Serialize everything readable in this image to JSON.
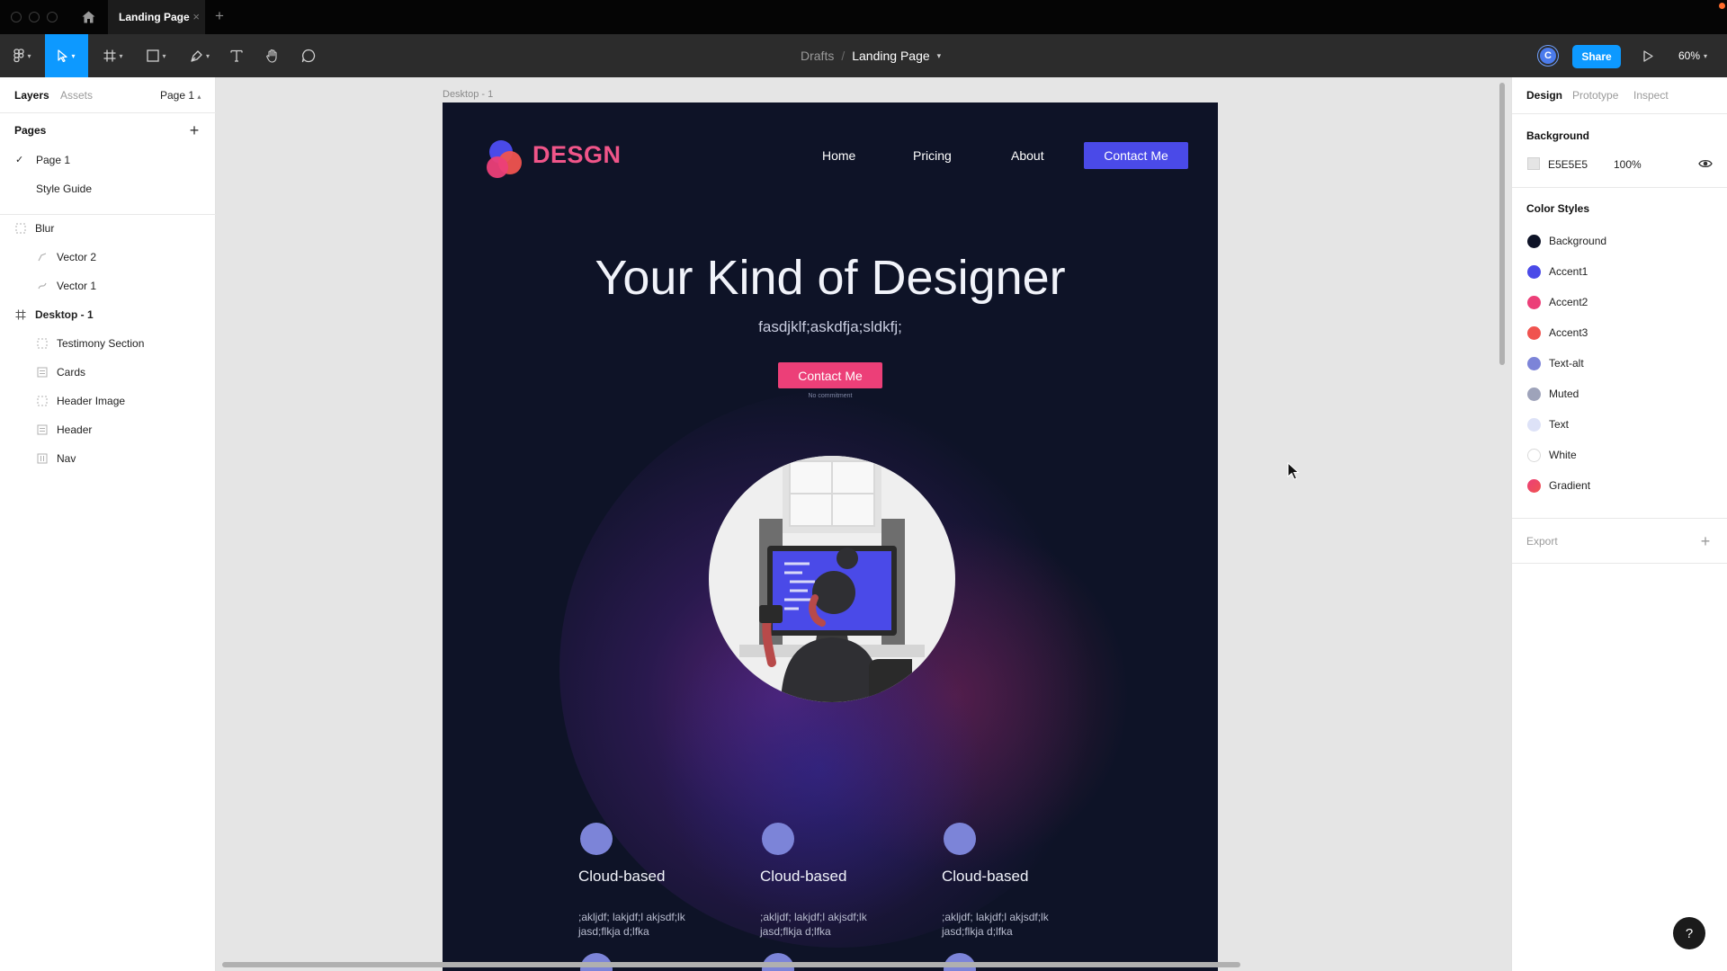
{
  "titlebar": {
    "tab_label": "Landing Page",
    "tab_close": "×",
    "tab_add": "+"
  },
  "toolbar": {
    "breadcrumb_drafts": "Drafts",
    "breadcrumb_sep": "/",
    "breadcrumb_file": "Landing Page",
    "avatar_initial": "C",
    "share_label": "Share",
    "zoom_label": "60%"
  },
  "left_panel": {
    "tabs": [
      "Layers",
      "Assets"
    ],
    "page_selector": "Page 1",
    "pages_heading": "Pages",
    "pages": [
      "Page 1",
      "Style Guide"
    ],
    "layers": [
      {
        "name": "Blur",
        "icon": "group-icon"
      },
      {
        "name": "Vector 2",
        "icon": "vector-icon"
      },
      {
        "name": "Vector 1",
        "icon": "vector-icon"
      },
      {
        "name": "Desktop - 1",
        "icon": "frame-icon"
      },
      {
        "name": "Testimony Section",
        "icon": "group-icon"
      },
      {
        "name": "Cards",
        "icon": "autolayout-icon"
      },
      {
        "name": "Header Image",
        "icon": "group-icon"
      },
      {
        "name": "Header",
        "icon": "autolayout-icon"
      },
      {
        "name": "Nav",
        "icon": "autolayout-icon"
      }
    ]
  },
  "canvas": {
    "frame_label": "Desktop - 1",
    "site": {
      "brand": "DESGN",
      "nav": [
        "Home",
        "Pricing",
        "About"
      ],
      "nav_cta": "Contact Me",
      "hero_title": "Your Kind of Designer",
      "hero_subtitle": "fasdjklf;askdfja;sldkfj;",
      "hero_cta": "Contact Me",
      "hero_note": "No commitment",
      "cards": [
        {
          "title": "Cloud-based",
          "text": ";akljdf; lakjdf;l akjsdf;lk jasd;flkja d;lfka"
        },
        {
          "title": "Cloud-based",
          "text": ";akljdf; lakjdf;l akjsdf;lk jasd;flkja d;lfka"
        },
        {
          "title": "Cloud-based",
          "text": ";akljdf; lakjdf;l akjsdf;lk jasd;flkja d;lfka"
        }
      ]
    }
  },
  "right_panel": {
    "tabs": [
      "Design",
      "Prototype",
      "Inspect"
    ],
    "background_heading": "Background",
    "background_hex": "E5E5E5",
    "background_opacity": "100%",
    "color_styles_heading": "Color Styles",
    "color_styles": [
      {
        "name": "Background",
        "color": "#0e1327"
      },
      {
        "name": "Accent1",
        "color": "#4a4ae8"
      },
      {
        "name": "Accent2",
        "color": "#ec3f78"
      },
      {
        "name": "Accent3",
        "color": "#f0534f"
      },
      {
        "name": "Text-alt",
        "color": "#7c84d8"
      },
      {
        "name": "Muted",
        "color": "#9ea3ba"
      },
      {
        "name": "Text",
        "color": "#dde2f7"
      },
      {
        "name": "White",
        "color": "#ffffff"
      },
      {
        "name": "Gradient",
        "color": "#ec3f78"
      }
    ],
    "export_label": "Export"
  },
  "help_label": "?"
}
